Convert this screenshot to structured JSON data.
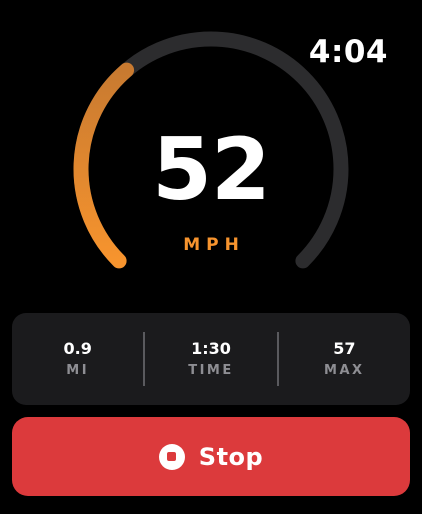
{
  "status_bar": {
    "time": "4:04"
  },
  "speedometer": {
    "speed": "52",
    "unit": "MPH",
    "progress_fraction": 0.35,
    "arc_start_color": "#f7942e",
    "arc_end_color": "#c87a30",
    "track_color": "#2c2c2e",
    "unit_color": "#f7942e"
  },
  "stats": [
    {
      "value": "0.9",
      "label": "MI"
    },
    {
      "value": "1:30",
      "label": "TIME"
    },
    {
      "value": "57",
      "label": "MAX"
    }
  ],
  "stop_button": {
    "label": "Stop",
    "icon": "stop-circle-icon",
    "color": "#dc3a3c"
  }
}
